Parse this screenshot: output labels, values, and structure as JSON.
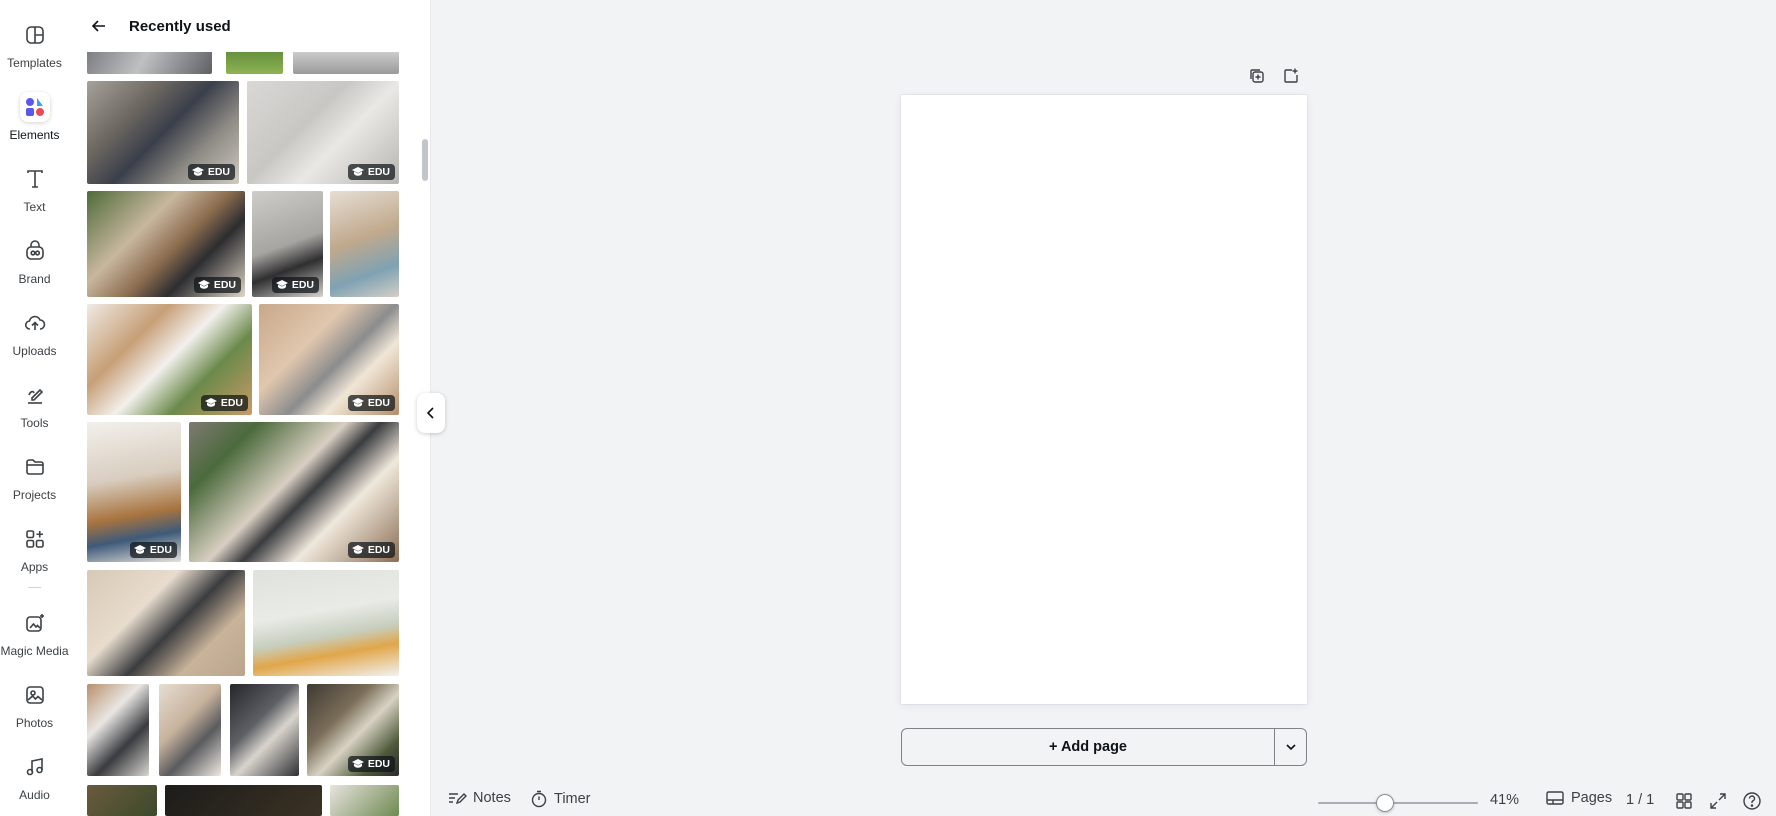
{
  "rail": {
    "items": [
      {
        "label": "Templates",
        "icon": "templates-icon"
      },
      {
        "label": "Elements",
        "icon": "elements-icon"
      },
      {
        "label": "Text",
        "icon": "text-icon"
      },
      {
        "label": "Brand",
        "icon": "brand-icon"
      },
      {
        "label": "Uploads",
        "icon": "uploads-icon"
      },
      {
        "label": "Tools",
        "icon": "tools-icon"
      },
      {
        "label": "Projects",
        "icon": "projects-icon"
      },
      {
        "label": "Apps",
        "icon": "apps-icon"
      },
      {
        "label": "Magic Media",
        "icon": "magic-media-icon"
      },
      {
        "label": "Photos",
        "icon": "photos-icon"
      },
      {
        "label": "Audio",
        "icon": "audio-icon"
      }
    ],
    "active": "Elements"
  },
  "panel": {
    "title": "Recently used",
    "badge_label": "EDU"
  },
  "canvas": {
    "add_page_label": "+ Add page"
  },
  "footer": {
    "notes_label": "Notes",
    "timer_label": "Timer",
    "zoom_label": "41%",
    "zoom_value": 41,
    "pages_label": "Pages",
    "page_count": "1 / 1"
  },
  "colors": {
    "background": "#f2f3f5",
    "panel": "#ffffff",
    "text": "#0e1318",
    "elements_icon": [
      "#5a57ec",
      "#35a2f6",
      "#e84b55"
    ]
  }
}
